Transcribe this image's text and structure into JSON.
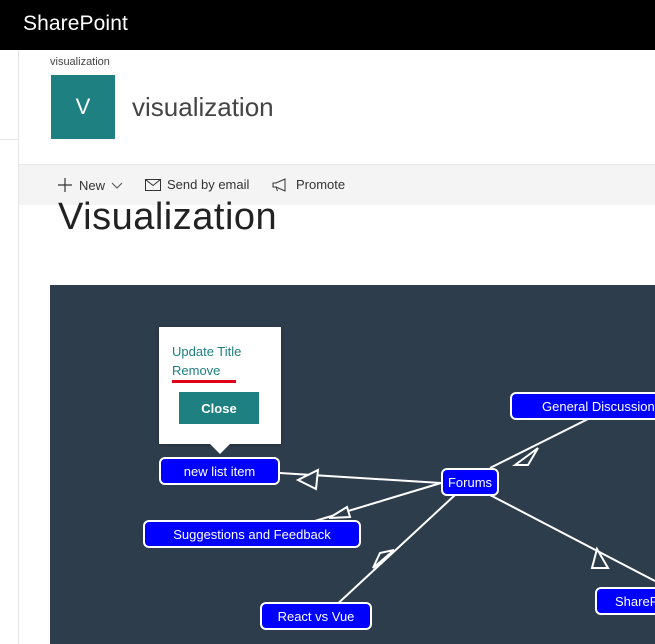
{
  "suite": {
    "title": "SharePoint"
  },
  "site": {
    "breadcrumb": "visualization",
    "logo_letter": "V",
    "title": "visualization"
  },
  "commands": {
    "new_label": "New",
    "send_label": "Send by email",
    "promote_label": "Promote"
  },
  "page": {
    "heading": "Visualization"
  },
  "graph": {
    "nodes": {
      "forums": "Forums",
      "general": "General Discussion",
      "new_item": "new list item",
      "suggestions": "Suggestions and Feedback",
      "react": "React vs Vue",
      "sharepoint": "SharePoint"
    }
  },
  "popover": {
    "update_title": "Update Title",
    "remove": "Remove",
    "close": "Close"
  },
  "colors": {
    "accent": "#1e8080",
    "node_fill": "#0000ff",
    "canvas_bg": "#2e3d4c",
    "underline": "#e0001b"
  }
}
